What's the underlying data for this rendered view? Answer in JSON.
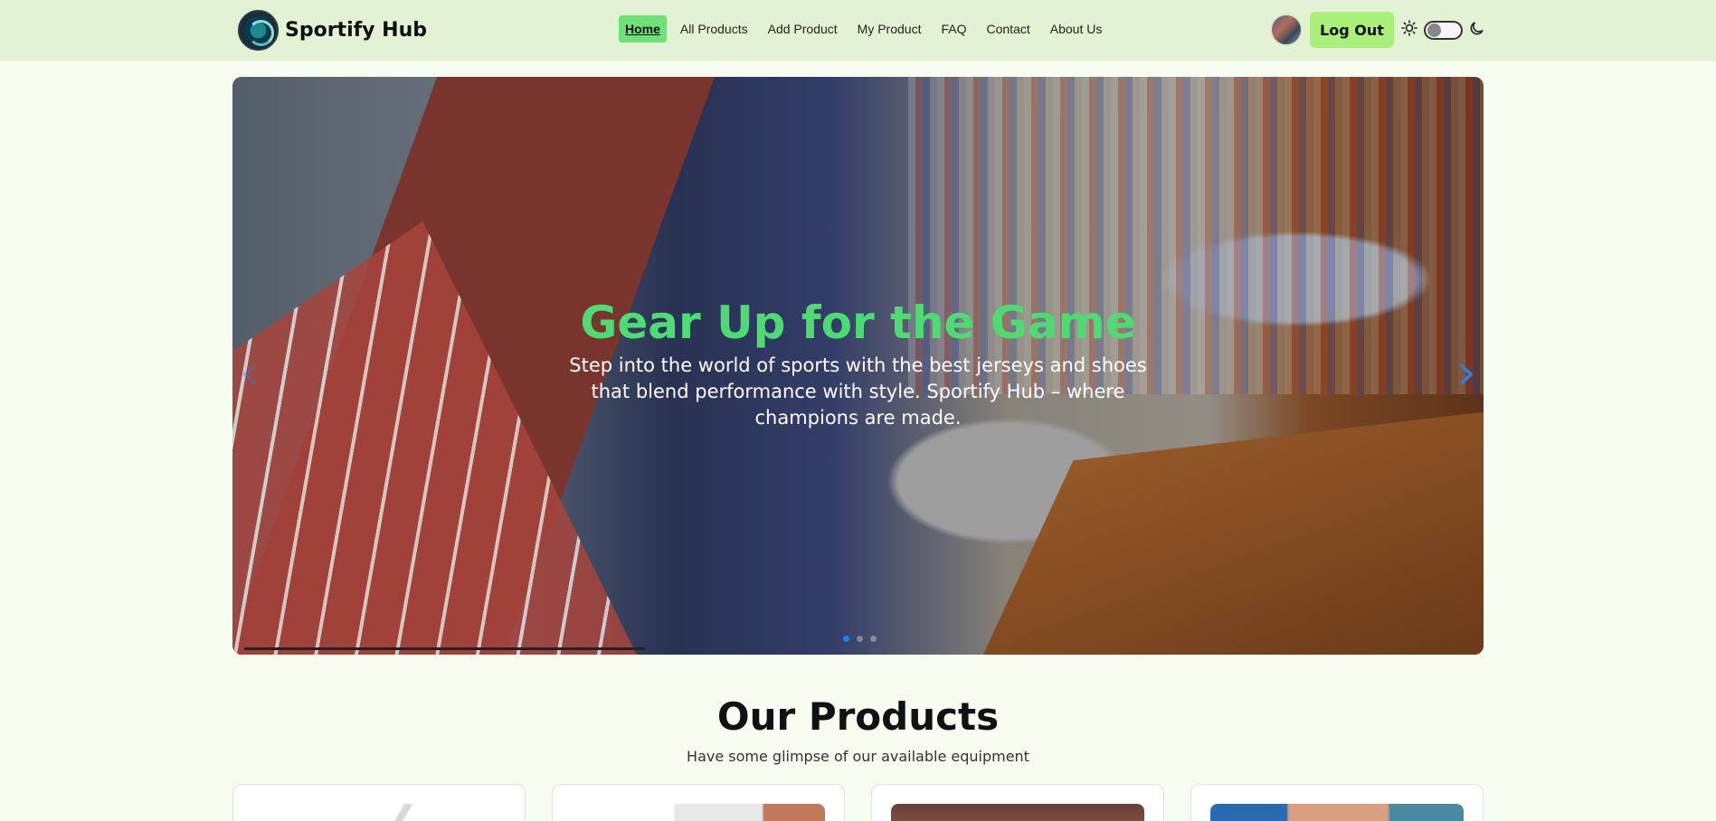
{
  "brand": {
    "name": "Sportify Hub"
  },
  "nav": {
    "items": [
      {
        "label": "Home",
        "active": true
      },
      {
        "label": "All Products"
      },
      {
        "label": "Add Product"
      },
      {
        "label": "My Product"
      },
      {
        "label": "FAQ"
      },
      {
        "label": "Contact"
      },
      {
        "label": "About Us"
      }
    ],
    "logout_label": "Log Out",
    "theme_toggle": {
      "state": "off",
      "icons": [
        "sun-icon",
        "moon-icon"
      ]
    }
  },
  "hero": {
    "title": "Gear Up for the Game",
    "subtitle": "Step into the world of sports with the best jerseys and shoes that blend performance with style. Sportify Hub – where champions are made.",
    "slide_count": 3,
    "active_slide": 1,
    "prev_icon": "chevron-left-icon",
    "next_icon": "chevron-right-icon"
  },
  "products": {
    "title": "Our Products",
    "subtitle": "Have some glimpse of our available equipment"
  },
  "colors": {
    "navbar_bg": "#e3f2d3",
    "page_bg": "#f7fdf0",
    "accent_green": "#6fe07a",
    "logout_bg": "#a8f07a",
    "hero_title": "#4fdb74",
    "carousel_blue": "#1e7ff0"
  }
}
